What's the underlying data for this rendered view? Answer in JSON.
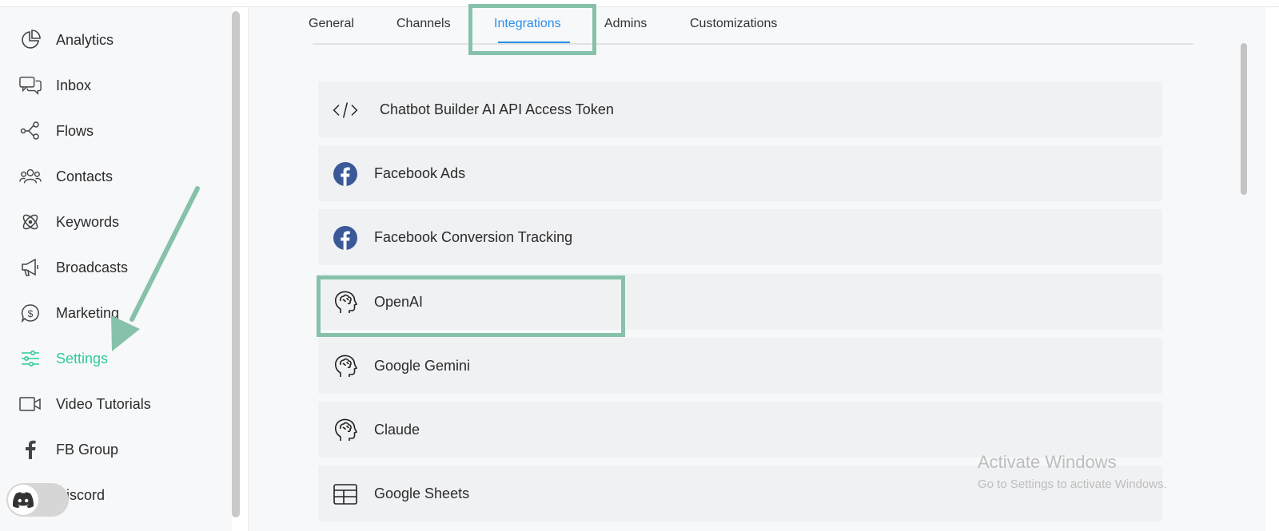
{
  "sidebar": {
    "items": [
      {
        "label": "Analytics",
        "icon": "pie-chart-icon"
      },
      {
        "label": "Inbox",
        "icon": "chat-bubbles-icon"
      },
      {
        "label": "Flows",
        "icon": "flow-nodes-icon"
      },
      {
        "label": "Contacts",
        "icon": "people-icon"
      },
      {
        "label": "Keywords",
        "icon": "atom-icon"
      },
      {
        "label": "Broadcasts",
        "icon": "megaphone-icon"
      },
      {
        "label": "Marketing",
        "icon": "dollar-bubble-icon"
      },
      {
        "label": "Settings",
        "icon": "sliders-icon",
        "active": true
      },
      {
        "label": "Video Tutorials",
        "icon": "video-camera-icon"
      },
      {
        "label": "FB Group",
        "icon": "facebook-f-icon"
      },
      {
        "label": "Discord",
        "icon": "discord-icon"
      }
    ]
  },
  "tabs": [
    {
      "label": "General"
    },
    {
      "label": "Channels"
    },
    {
      "label": "Integrations",
      "active": true
    },
    {
      "label": "Admins"
    },
    {
      "label": "Customizations"
    }
  ],
  "integrations": [
    {
      "label": "Chatbot Builder AI API Access Token",
      "icon": "code-icon"
    },
    {
      "label": "Facebook Ads",
      "icon": "facebook-icon"
    },
    {
      "label": "Facebook Conversion Tracking",
      "icon": "facebook-icon"
    },
    {
      "label": "OpenAI",
      "icon": "brain-head-icon"
    },
    {
      "label": "Google Gemini",
      "icon": "brain-head-icon"
    },
    {
      "label": "Claude",
      "icon": "brain-head-icon"
    },
    {
      "label": "Google Sheets",
      "icon": "table-icon"
    }
  ],
  "watermark": {
    "title": "Activate Windows",
    "subtitle": "Go to Settings to activate Windows."
  },
  "colors": {
    "accent_green": "#2ecc9a",
    "tab_blue": "#2a8ee8",
    "annotation_green": "#86c2aa",
    "facebook_blue": "#3b5998"
  }
}
